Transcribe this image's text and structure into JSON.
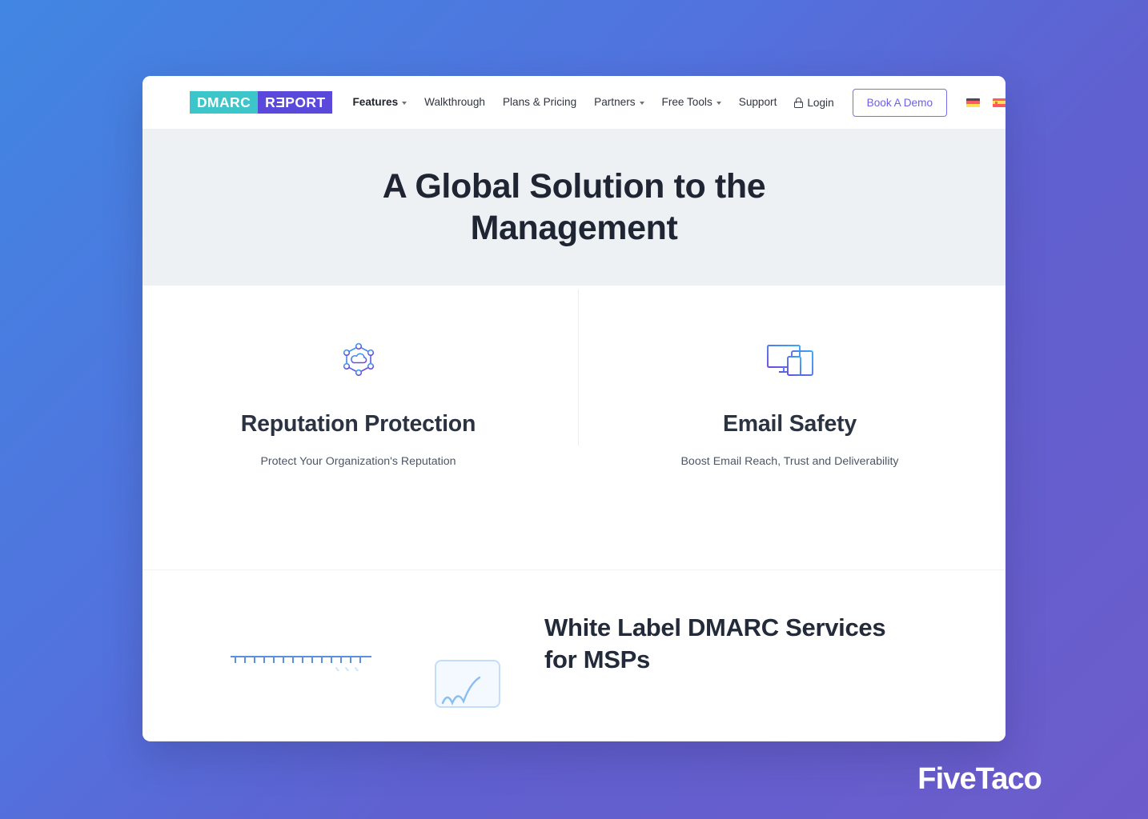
{
  "brand": {
    "logo_part1": "DMARC",
    "logo_part2_pre": "R",
    "logo_part2_rev": "E",
    "logo_part2_post": "PORT",
    "logo_full": "DMARC REPORT",
    "teal": "#3dc6c9",
    "purple": "#5b49db",
    "accent": "#6d5fe8"
  },
  "nav": {
    "items": [
      {
        "label": "Features",
        "has_caret": true
      },
      {
        "label": "Walkthrough",
        "has_caret": false
      },
      {
        "label": "Plans & Pricing",
        "has_caret": false
      },
      {
        "label": "Partners",
        "has_caret": true
      },
      {
        "label": "Free Tools",
        "has_caret": true
      },
      {
        "label": "Support",
        "has_caret": false
      }
    ],
    "login_label": "Login",
    "login_icon": "lock-icon",
    "demo_button": "Book A Demo",
    "flags": [
      {
        "name": "german-flag",
        "code": "de"
      },
      {
        "name": "spanish-flag",
        "code": "es"
      }
    ]
  },
  "hero": {
    "headline_line1": "A Global Solution to the",
    "headline_line2": "Management",
    "headline_full": "A Global Solution to the Management",
    "background": "#edf1f4"
  },
  "features": [
    {
      "icon": "network-cloud-icon",
      "title": "Reputation Protection",
      "subtitle": "Protect Your Organization's Reputation"
    },
    {
      "icon": "devices-icon",
      "title": "Email Safety",
      "subtitle": "Boost Email Reach, Trust and Deliverability"
    }
  ],
  "promo": {
    "heading_line1": "White Label DMARC Services",
    "heading_line2": "for MSPs",
    "heading_full": "White Label DMARC Services for MSPs",
    "illustrations": [
      "ruler-illustration",
      "chart-card-illustration"
    ]
  },
  "watermark": {
    "text": "FiveTaco"
  },
  "page_background": {
    "gradient_from": "#4186e2",
    "gradient_to": "#6d5ccb"
  }
}
